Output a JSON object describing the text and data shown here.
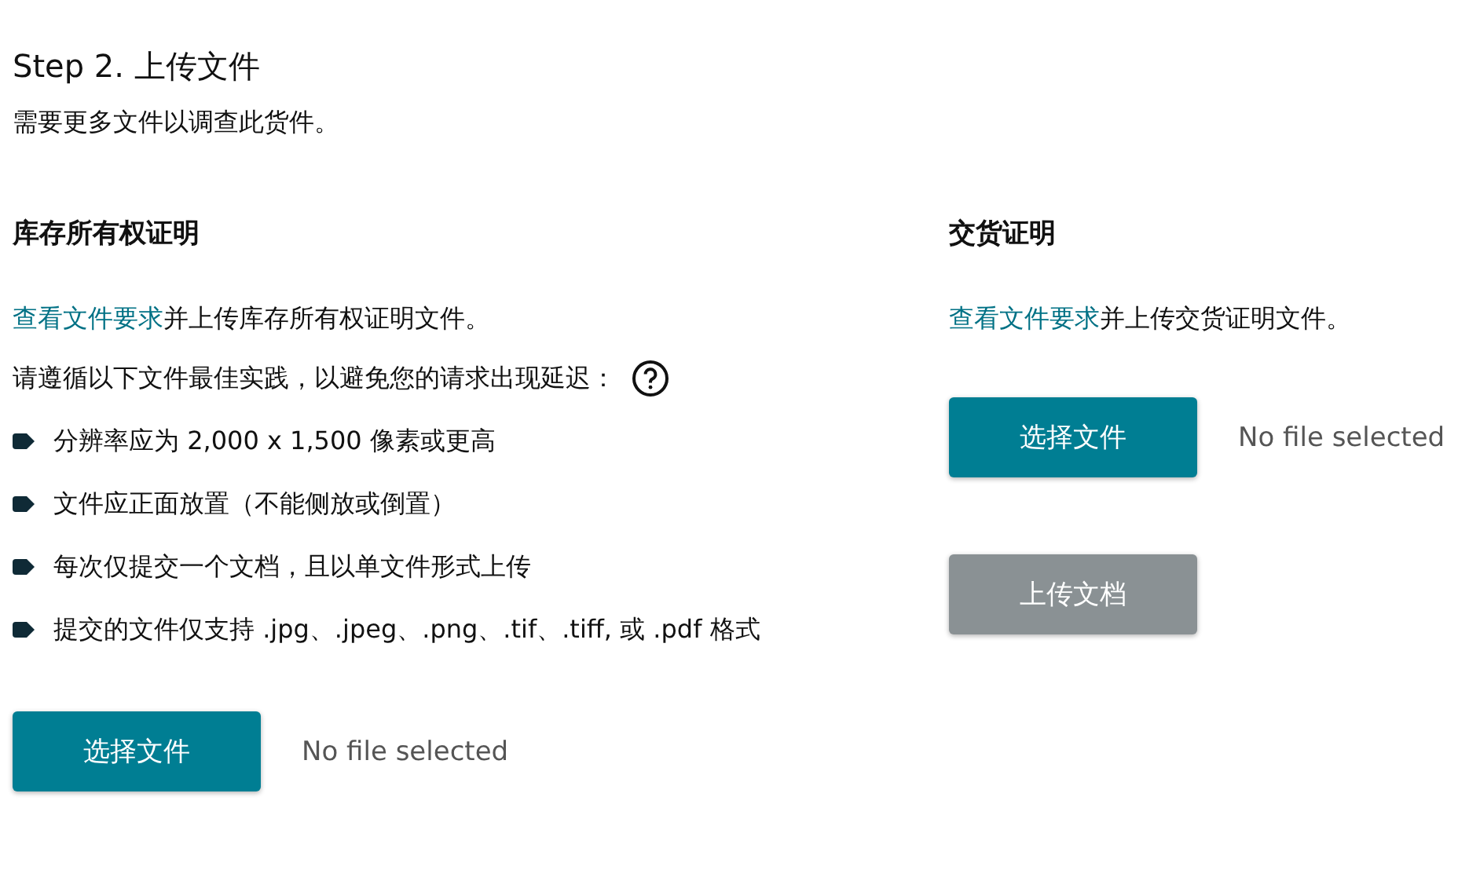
{
  "step_title": "Step 2. 上传文件",
  "subtitle": "需要更多文件以调查此货件。",
  "sections": [
    {
      "heading": "库存所有权证明",
      "link": "查看文件要求",
      "text": "并上传库存所有权证明文件。",
      "note": "请遵循以下文件最佳实践，以避免您的请求出现延迟：",
      "bullets": [
        "分辨率应为 2,000 x 1,500 像素或更高",
        "文件应正面放置（不能侧放或倒置）",
        "每次仅提交一个文档，且以单文件形式上传",
        "提交的文件仅支持 .jpg、.jpeg、.png、.tif、.tiff, 或 .pdf 格式"
      ],
      "choose_button": "选择文件",
      "file_status": "No file selected"
    },
    {
      "heading": "交货证明",
      "link": "查看文件要求",
      "text": "并上传交货证明文件。",
      "choose_button": "选择文件",
      "file_status": "No file selected",
      "upload_button": {
        "label": "上传文档",
        "disabled": true
      }
    }
  ]
}
